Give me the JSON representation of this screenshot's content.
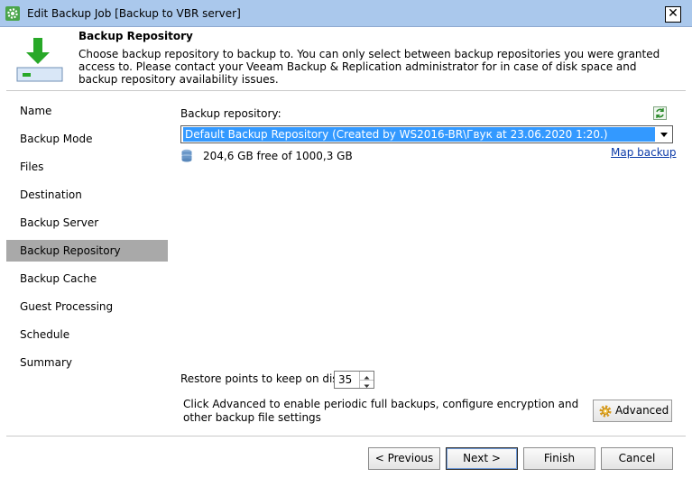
{
  "window": {
    "title": "Edit Backup Job [Backup to VBR server]",
    "close_glyph": "✕"
  },
  "header": {
    "title": "Backup Repository",
    "description": "Choose backup repository to backup to. You can only select between backup repositories you were granted access to. Please contact your Veeam Backup & Replication administrator for in case of disk space and backup repository availability issues.",
    "icon": "download-to-disk-icon"
  },
  "sidebar": {
    "items": [
      {
        "label": "Name"
      },
      {
        "label": "Backup Mode"
      },
      {
        "label": "Files"
      },
      {
        "label": "Destination"
      },
      {
        "label": "Backup Server"
      },
      {
        "label": "Backup Repository",
        "active": true
      },
      {
        "label": "Backup Cache"
      },
      {
        "label": "Guest Processing"
      },
      {
        "label": "Schedule"
      },
      {
        "label": "Summary"
      }
    ]
  },
  "main": {
    "repo_label": "Backup repository:",
    "repo_selected": "Default Backup Repository (Created by WS2016-BR\\Гвук at 23.06.2020 1:20.)",
    "free_space": "204,6 GB free of 1000,3 GB",
    "map_backup": "Map backup",
    "restore_label": "Restore points to keep on disk:",
    "restore_value": "35",
    "advanced_text": "Click Advanced to enable periodic full backups, configure encryption and other backup file settings",
    "advanced_label": "Advanced"
  },
  "footer": {
    "previous": "< Previous",
    "next": "Next >",
    "finish": "Finish",
    "cancel": "Cancel"
  },
  "colors": {
    "titlebar": "#aac8ec",
    "selection": "#3399ff",
    "active_nav": "#a9a9a9",
    "link": "#0b3aa8",
    "accent_green": "#22a822"
  }
}
